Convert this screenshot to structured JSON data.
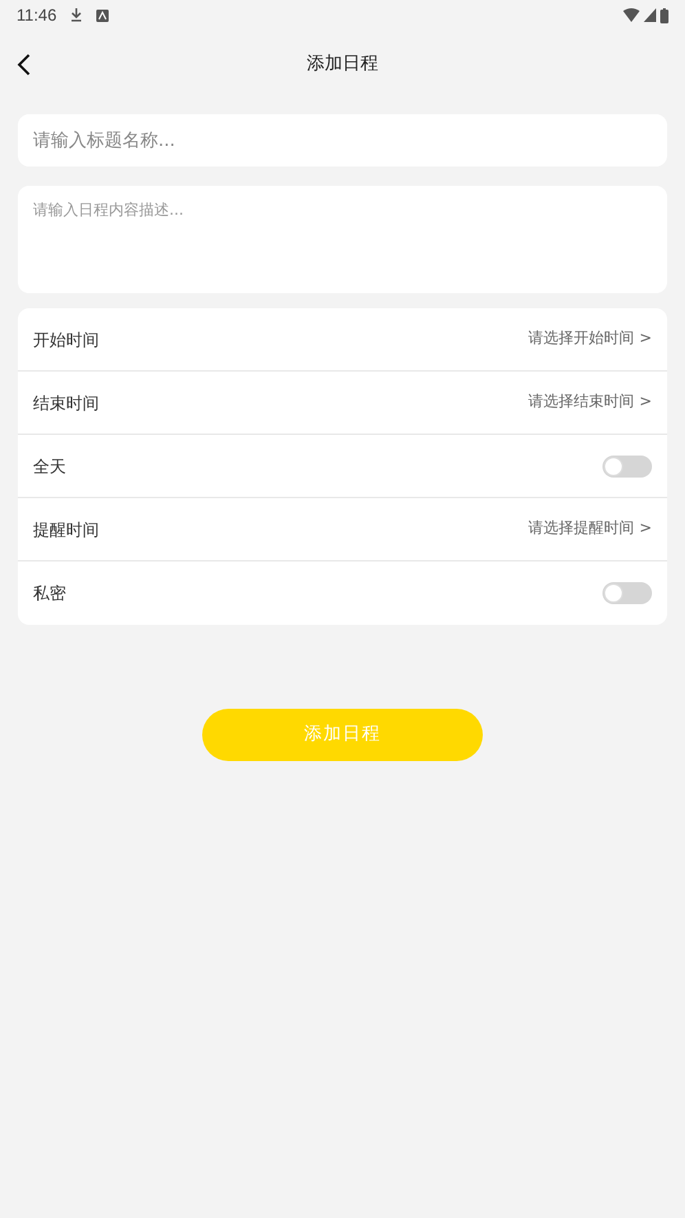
{
  "status_bar": {
    "time": "11:46"
  },
  "header": {
    "title": "添加日程"
  },
  "title_field": {
    "placeholder": "请输入标题名称..."
  },
  "description_field": {
    "placeholder": "请输入日程内容描述..."
  },
  "settings": [
    {
      "kind": "picker",
      "label": "开始时间",
      "value": "请选择开始时间",
      "arrow": ">"
    },
    {
      "kind": "picker",
      "label": "结束时间",
      "value": "请选择结束时间",
      "arrow": ">"
    },
    {
      "kind": "switch",
      "label": "全天",
      "on": false
    },
    {
      "kind": "picker",
      "label": "提醒时间",
      "value": "请选择提醒时间",
      "arrow": ">"
    },
    {
      "kind": "switch",
      "label": "私密",
      "on": false
    }
  ],
  "submit_button": {
    "label": "添加日程"
  }
}
